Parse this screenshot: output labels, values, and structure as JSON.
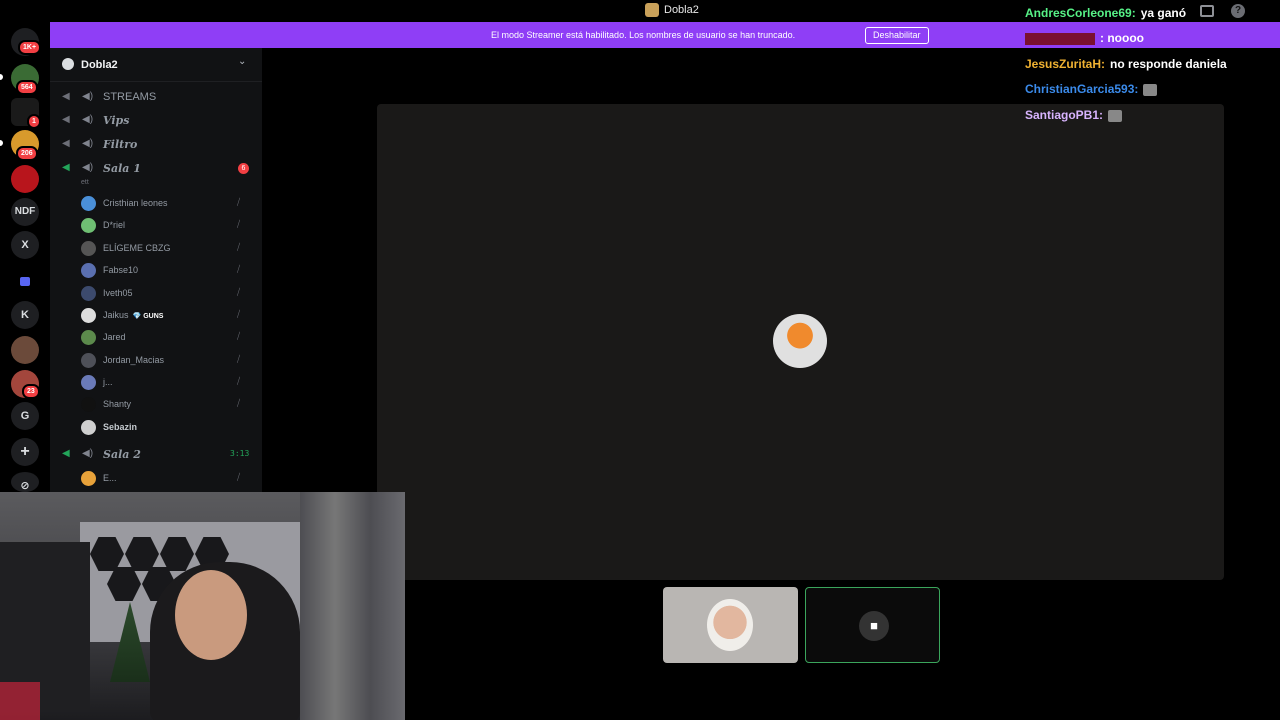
{
  "window": {
    "title": "Dobla2"
  },
  "banner": {
    "message": "El modo Streamer está habilitado. Los nombres de usuario se han truncado.",
    "button": "Deshabilitar"
  },
  "rail": {
    "items": [
      {
        "kind": "discord-home",
        "badge": "1K+"
      },
      {
        "kind": "server",
        "badge": "564"
      },
      {
        "kind": "server",
        "badge": "1"
      },
      {
        "kind": "server",
        "badge": "206"
      },
      {
        "kind": "server",
        "badge": ""
      },
      {
        "kind": "text",
        "label": "NDF"
      },
      {
        "kind": "text",
        "label": "X"
      },
      {
        "kind": "folder",
        "label": ""
      },
      {
        "kind": "text",
        "label": "K"
      },
      {
        "kind": "server",
        "badge": ""
      },
      {
        "kind": "server",
        "badge": "23"
      },
      {
        "kind": "text",
        "label": "G"
      }
    ]
  },
  "server": {
    "name": "Dobla2",
    "channels": [
      {
        "name": "STREAMS",
        "style": "plain"
      },
      {
        "name": "Vips"
      },
      {
        "name": "Filtro"
      },
      {
        "name": "Sala 1",
        "count": "6",
        "sub": "ett"
      },
      {
        "name": "Sala 2",
        "timer": "3:13"
      }
    ],
    "sala1_members": [
      "Cristhian leones",
      "D*riel",
      "ELÍGEME CBZG",
      "Fabse10",
      "Iveth05",
      "Jaikus",
      "Jared",
      "Jordan_Macias",
      "j...",
      "Shanty",
      "Sebazin"
    ],
    "jaikus_tag": "GUNS",
    "sala2_members": [
      "E..."
    ]
  },
  "chat": {
    "lines": [
      {
        "user": "AndresCorleone69:",
        "text": "ya ganó",
        "color": "#57f287"
      },
      {
        "user": "",
        "text": ": noooo",
        "color": "#e91e63"
      },
      {
        "user": "JesusZuritaH:",
        "text": "no responde daniela",
        "color": "#f0b232"
      },
      {
        "user": "ChristianGarcia593:",
        "text": "",
        "color": "#3b8beb"
      },
      {
        "user": "SantiagoPB1:",
        "text": "",
        "color": "#d8b4fe"
      }
    ]
  },
  "colors": {
    "banner": "#8f3ef6",
    "live": "#23a55a",
    "badge": "#f23f43"
  }
}
